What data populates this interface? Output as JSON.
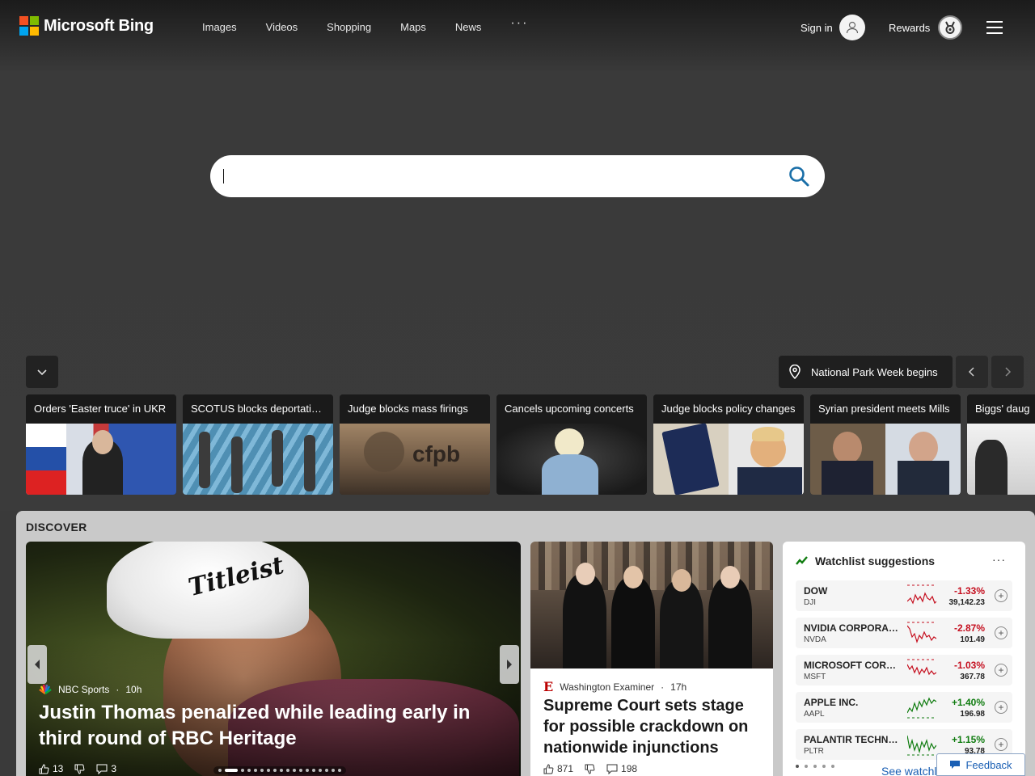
{
  "header": {
    "brand": "Microsoft Bing",
    "nav": [
      "Images",
      "Videos",
      "Shopping",
      "Maps",
      "News"
    ],
    "more": "···",
    "signin": "Sign in",
    "rewards": "Rewards"
  },
  "search": {
    "value": "",
    "placeholder": ""
  },
  "hotspot": "National Park Week begins",
  "trending": [
    {
      "label": "Orders 'Easter truce' in UKR"
    },
    {
      "label": "SCOTUS blocks deportati…"
    },
    {
      "label": "Judge blocks mass firings"
    },
    {
      "label": "Cancels upcoming concerts"
    },
    {
      "label": "Judge blocks policy changes"
    },
    {
      "label": "Syrian president meets Mills"
    },
    {
      "label": "Biggs' daug"
    }
  ],
  "discover": {
    "title": "DISCOVER",
    "featured": {
      "source": "NBC Sports",
      "age": "10h",
      "headline": "Justin Thomas penalized while leading early in third round of RBC Heritage",
      "likes": "13",
      "comments": "3"
    },
    "secondary": {
      "source": "Washington Examiner",
      "age": "17h",
      "headline": "Supreme Court sets stage for possible crackdown on nationwide injunctions",
      "likes": "871",
      "comments": "198"
    },
    "watchlist": {
      "title": "Watchlist suggestions",
      "more": "···",
      "stocks": [
        {
          "name": "DOW",
          "symbol": "DJI",
          "change": "-1.33%",
          "price": "39,142.23",
          "trend": "down"
        },
        {
          "name": "NVIDIA CORPORA…",
          "symbol": "NVDA",
          "change": "-2.87%",
          "price": "101.49",
          "trend": "down"
        },
        {
          "name": "MICROSOFT CORP…",
          "symbol": "MSFT",
          "change": "-1.03%",
          "price": "367.78",
          "trend": "down"
        },
        {
          "name": "APPLE INC.",
          "symbol": "AAPL",
          "change": "+1.40%",
          "price": "196.98",
          "trend": "up"
        },
        {
          "name": "PALANTIR TECHN…",
          "symbol": "PLTR",
          "change": "+1.15%",
          "price": "93.78",
          "trend": "up"
        }
      ],
      "link": "See watchlist"
    }
  },
  "feedback": "Feedback",
  "colors": {
    "accent": "#1a5fb4",
    "negative": "#c50f1f",
    "positive": "#107c10"
  }
}
